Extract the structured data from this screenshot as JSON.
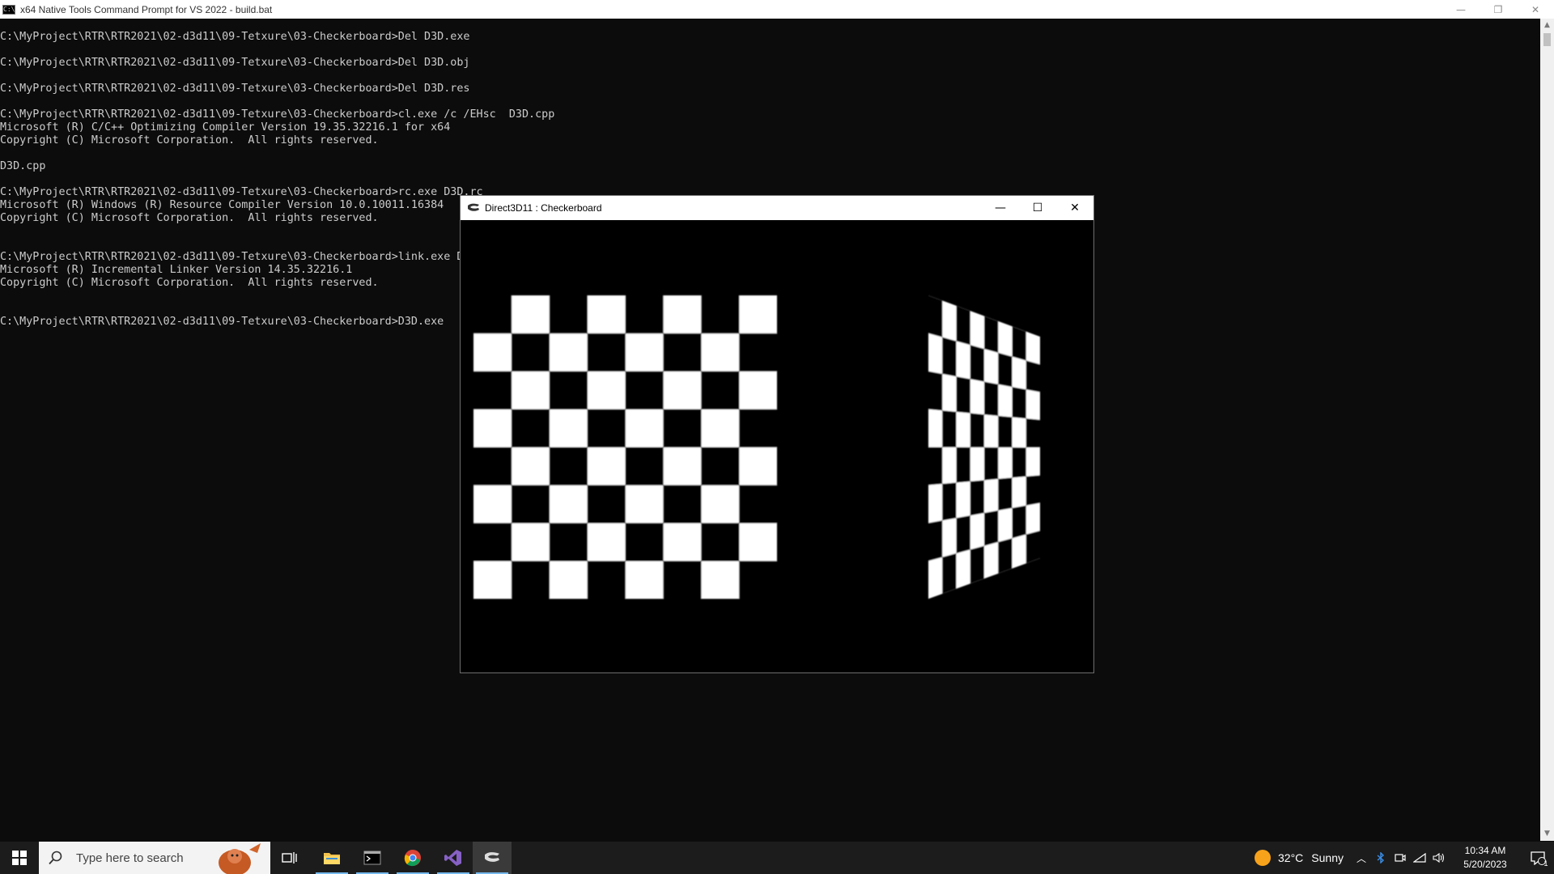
{
  "console_window": {
    "title": "x64 Native Tools Command Prompt for VS 2022 - build.bat",
    "icon_text": "C:\\.",
    "lines": [
      "C:\\MyProject\\RTR\\RTR2021\\02-d3d11\\09-Tetxure\\03-Checkerboard>Del D3D.exe",
      "",
      "C:\\MyProject\\RTR\\RTR2021\\02-d3d11\\09-Tetxure\\03-Checkerboard>Del D3D.obj",
      "",
      "C:\\MyProject\\RTR\\RTR2021\\02-d3d11\\09-Tetxure\\03-Checkerboard>Del D3D.res",
      "",
      "C:\\MyProject\\RTR\\RTR2021\\02-d3d11\\09-Tetxure\\03-Checkerboard>cl.exe /c /EHsc  D3D.cpp",
      "Microsoft (R) C/C++ Optimizing Compiler Version 19.35.32216.1 for x64",
      "Copyright (C) Microsoft Corporation.  All rights reserved.",
      "",
      "D3D.cpp",
      "",
      "C:\\MyProject\\RTR\\RTR2021\\02-d3d11\\09-Tetxure\\03-Checkerboard>rc.exe D3D.rc",
      "Microsoft (R) Windows (R) Resource Compiler Version 10.0.10011.16384",
      "Copyright (C) Microsoft Corporation.  All rights reserved.",
      "",
      "",
      "C:\\MyProject\\RTR\\RTR2021\\02-d3d11\\09-Tetxure\\03-Checkerboard>link.exe D",
      "Microsoft (R) Incremental Linker Version 14.35.32216.1",
      "Copyright (C) Microsoft Corporation.  All rights reserved.",
      "",
      "",
      "C:\\MyProject\\RTR\\RTR2021\\02-d3d11\\09-Tetxure\\03-Checkerboard>D3D.exe"
    ]
  },
  "d3d_window": {
    "title": "Direct3D11 : Checkerboard",
    "minimize": "—",
    "maximize": "☐",
    "close": "✕",
    "checkerboard_rows": 8,
    "checkerboard_cols": 8
  },
  "taskbar": {
    "search_placeholder": "Type here to search",
    "weather_temp": "32°C",
    "weather_desc": "Sunny",
    "time": "10:34 AM",
    "date": "5/20/2023",
    "notification_count": "1"
  },
  "colors": {
    "console_bg": "#0c0c0c",
    "console_text": "#cccccc",
    "taskbar_bg": "#1c1c1c",
    "accent": "#76b9ed"
  }
}
